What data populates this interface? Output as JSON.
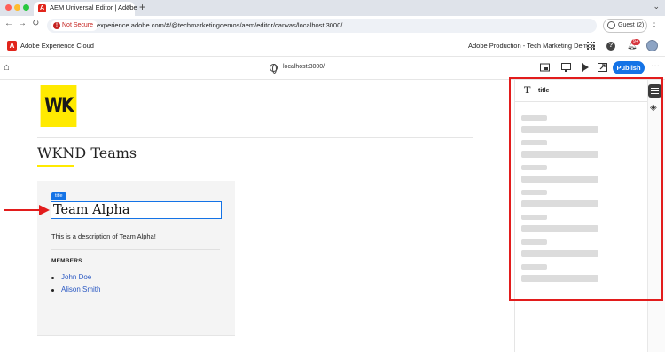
{
  "browser": {
    "tab_title": "AEM Universal Editor | Adobe",
    "url": "experience.adobe.com/#/@techmarketingdemos/aem/editor/canvas/localhost:3000/",
    "security_label": "Not Secure",
    "profile_label": "Guest (2)",
    "new_tab_glyph": "+",
    "close_glyph": "×",
    "traffic_light_colors": [
      "#ff5f57",
      "#febc2e",
      "#28c840"
    ]
  },
  "shell": {
    "brand_glyph": "A",
    "product_name": "Adobe Experience Cloud",
    "org_name": "Adobe Production - Tech Marketing Demos",
    "notification_count": "9+",
    "help_glyph": "?"
  },
  "toolbar": {
    "page_url": "localhost:3000/",
    "publish_label": "Publish",
    "more_glyph": "···",
    "home_glyph": "⌂",
    "accent_color": "#1473e6"
  },
  "canvas": {
    "logo_text": "WK",
    "page_title": "WKND Teams",
    "selected_badge": "title",
    "team_title": "Team Alpha",
    "team_description": "This is a description of Team Alpha!",
    "members_label": "MEMBERS",
    "members": [
      "John Doe",
      "Alison Smith"
    ],
    "logo_color": "#ffea00"
  },
  "panel": {
    "type_icon_glyph": "T",
    "component_name": "title",
    "layers_glyph": "◈"
  },
  "annotations": {
    "highlight_color": "#e21c1c"
  }
}
